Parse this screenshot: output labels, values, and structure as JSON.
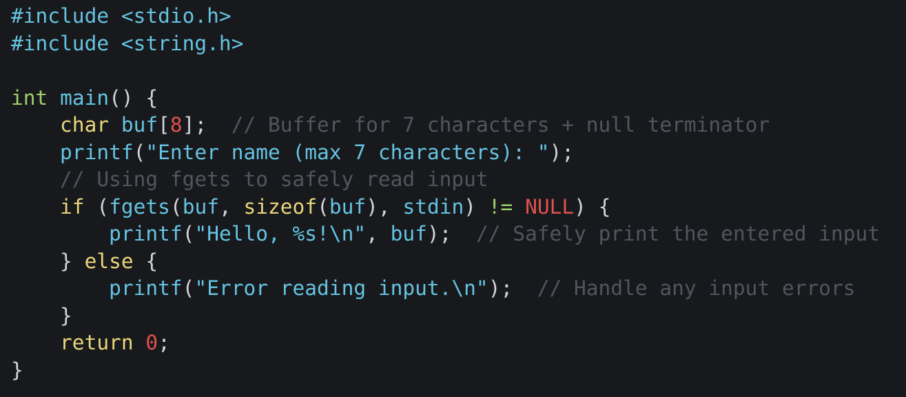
{
  "colors": {
    "background": "#18191c",
    "preprocessor": "#65c4e2",
    "type": "#9ed06c",
    "keyword": "#e9d77a",
    "function": "#65c4e2",
    "string": "#65c4e2",
    "number": "#e0524f",
    "comment": "#505660",
    "plain": "#d3d5da"
  },
  "lines": [
    [
      {
        "t": "preproc",
        "v": "#include <stdio.h>"
      }
    ],
    [
      {
        "t": "preproc",
        "v": "#include <string.h>"
      }
    ],
    [],
    [
      {
        "t": "type",
        "v": "int"
      },
      {
        "t": "plain",
        "v": " "
      },
      {
        "t": "func",
        "v": "main"
      },
      {
        "t": "plain",
        "v": "() {"
      }
    ],
    [
      {
        "t": "plain",
        "v": "    "
      },
      {
        "t": "keyword",
        "v": "char"
      },
      {
        "t": "plain",
        "v": " "
      },
      {
        "t": "ident",
        "v": "buf"
      },
      {
        "t": "plain",
        "v": "["
      },
      {
        "t": "number",
        "v": "8"
      },
      {
        "t": "plain",
        "v": "];  "
      },
      {
        "t": "comment",
        "v": "// Buffer for 7 characters + null terminator"
      }
    ],
    [
      {
        "t": "plain",
        "v": "    "
      },
      {
        "t": "func",
        "v": "printf"
      },
      {
        "t": "plain",
        "v": "("
      },
      {
        "t": "string",
        "v": "\"Enter name (max 7 characters): \""
      },
      {
        "t": "plain",
        "v": ");"
      }
    ],
    [
      {
        "t": "plain",
        "v": "    "
      },
      {
        "t": "comment",
        "v": "// Using fgets to safely read input"
      }
    ],
    [
      {
        "t": "plain",
        "v": "    "
      },
      {
        "t": "keyword",
        "v": "if"
      },
      {
        "t": "plain",
        "v": " ("
      },
      {
        "t": "func",
        "v": "fgets"
      },
      {
        "t": "plain",
        "v": "("
      },
      {
        "t": "ident",
        "v": "buf"
      },
      {
        "t": "plain",
        "v": ", "
      },
      {
        "t": "keyword",
        "v": "sizeof"
      },
      {
        "t": "plain",
        "v": "("
      },
      {
        "t": "ident",
        "v": "buf"
      },
      {
        "t": "plain",
        "v": "), "
      },
      {
        "t": "ident",
        "v": "stdin"
      },
      {
        "t": "plain",
        "v": ") "
      },
      {
        "t": "op",
        "v": "!="
      },
      {
        "t": "plain",
        "v": " "
      },
      {
        "t": "null",
        "v": "NULL"
      },
      {
        "t": "plain",
        "v": ") {"
      }
    ],
    [
      {
        "t": "plain",
        "v": "        "
      },
      {
        "t": "func",
        "v": "printf"
      },
      {
        "t": "plain",
        "v": "("
      },
      {
        "t": "string",
        "v": "\"Hello, %s!\\n\""
      },
      {
        "t": "plain",
        "v": ", "
      },
      {
        "t": "ident",
        "v": "buf"
      },
      {
        "t": "plain",
        "v": ");  "
      },
      {
        "t": "comment",
        "v": "// Safely print the entered input"
      }
    ],
    [
      {
        "t": "plain",
        "v": "    } "
      },
      {
        "t": "keyword",
        "v": "else"
      },
      {
        "t": "plain",
        "v": " {"
      }
    ],
    [
      {
        "t": "plain",
        "v": "        "
      },
      {
        "t": "func",
        "v": "printf"
      },
      {
        "t": "plain",
        "v": "("
      },
      {
        "t": "string",
        "v": "\"Error reading input.\\n\""
      },
      {
        "t": "plain",
        "v": ");  "
      },
      {
        "t": "comment",
        "v": "// Handle any input errors"
      }
    ],
    [
      {
        "t": "plain",
        "v": "    }"
      }
    ],
    [
      {
        "t": "plain",
        "v": "    "
      },
      {
        "t": "keyword",
        "v": "return"
      },
      {
        "t": "plain",
        "v": " "
      },
      {
        "t": "number",
        "v": "0"
      },
      {
        "t": "plain",
        "v": ";"
      }
    ],
    [
      {
        "t": "plain",
        "v": "}"
      }
    ]
  ]
}
